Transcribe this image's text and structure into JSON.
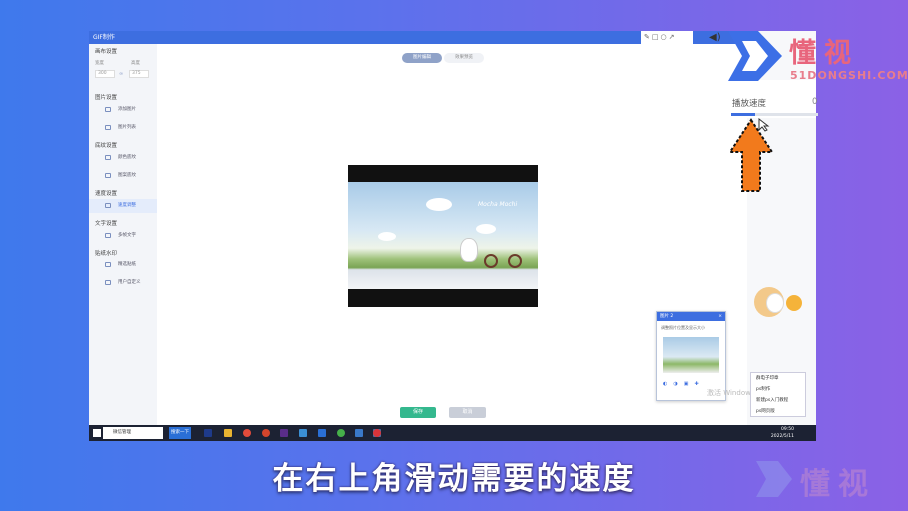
{
  "app": {
    "title": "GIF制作"
  },
  "sidebar": {
    "sections": [
      {
        "label": "画布设置"
      },
      {
        "label": "图片设置"
      },
      {
        "label": "底纹设置"
      },
      {
        "label": "速度设置"
      },
      {
        "label": "文字设置"
      },
      {
        "label": "贴纸水印"
      }
    ],
    "width_label": "宽度",
    "height_label": "高度",
    "width_value": "300",
    "height_value": "375",
    "items": [
      {
        "label": "添加图片"
      },
      {
        "label": "图片列表"
      },
      {
        "label": "颜色底纹"
      },
      {
        "label": "图案底纹"
      },
      {
        "label": "速度调整"
      },
      {
        "label": "多帧文字"
      },
      {
        "label": "精选贴纸"
      },
      {
        "label": "用户自定义"
      }
    ]
  },
  "tabs": [
    {
      "label": "图片编辑"
    },
    {
      "label": "效果预览"
    }
  ],
  "canvas": {
    "watermark": "Mocha Mochi"
  },
  "actions": {
    "save": "保存",
    "cancel": "取消"
  },
  "speed": {
    "label": "播放速度",
    "value": "0",
    "level": 0.28
  },
  "popup": {
    "title": "图片 2",
    "close": "×",
    "text": "调整照片位置及显示大小"
  },
  "context_menu": {
    "items": [
      "群电子印章",
      "ps制作",
      "新建ps入门教程",
      "ps网页版"
    ]
  },
  "activate_text": "激活 Windows",
  "taskbar": {
    "search_placeholder": "微信管理",
    "search_button": "搜索一下",
    "time": "09:50",
    "date": "2022/5/11"
  },
  "logo": {
    "brand": "懂视",
    "url": "51DONGSHI.COM"
  },
  "caption": "在右上角滑动需要的速度",
  "colors": {
    "accent": "#3d6ee0",
    "save": "#34b88e",
    "arrow": "#f27a1c",
    "brand": "#e8657c"
  }
}
